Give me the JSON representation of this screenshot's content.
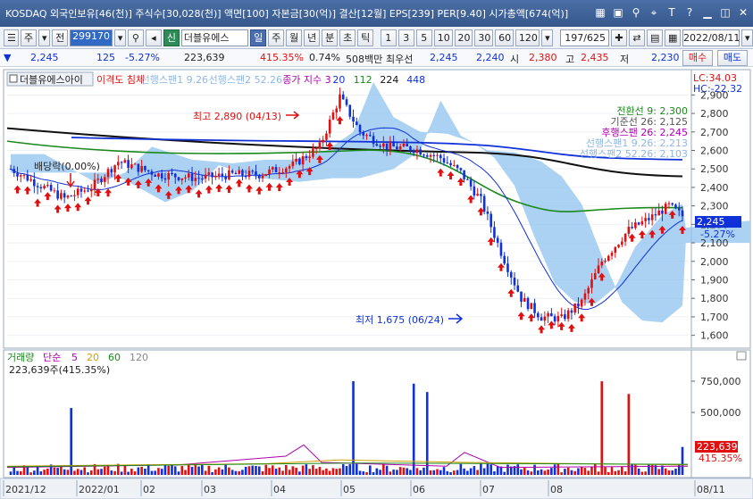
{
  "titlebar": {
    "title": "KOSDAQ 외국인보유[46(천)] 주식수[30,028(천)] 액면[100] 자본금[30(억)] 결산[12월] EPS[239] PER[9.40] 시가총액[674(억)]"
  },
  "toolbar": {
    "type_label": "주",
    "prev_label": "전",
    "code": "299170",
    "sin_label": "신",
    "name": "더블유에스",
    "periods": [
      "일",
      "주",
      "월",
      "년",
      "분",
      "초",
      "틱"
    ],
    "active_period": "일",
    "intervals": [
      "1",
      "3",
      "5",
      "10",
      "20",
      "30",
      "60",
      "120"
    ],
    "range_value": "197/625",
    "date_value": "2022/08/11"
  },
  "quote": {
    "price": "2,245",
    "change": "125",
    "change_pct": "-5.27%",
    "volume": "223,639",
    "volume_ratio": "415.35%",
    "turnover": "0.74%",
    "amount": "508백만",
    "priority_label": "최우선",
    "bid": "2,245",
    "ask": "2,240",
    "open_label": "시",
    "open": "2,380",
    "high_label": "고",
    "high": "2,435",
    "low_label": "저",
    "low": "2,230",
    "buy_label": "매수",
    "sell_label": "매도"
  },
  "legend": {
    "stock_name": "더블유에스아이",
    "items": [
      {
        "label": "이격도 침체",
        "color": "#e01010"
      },
      {
        "label": "선행스팬1 9.26",
        "color": "#8fb7e6"
      },
      {
        "label": "선행스팬2 52.26",
        "color": "#8fb7e6"
      },
      {
        "label": "종가 지수 3",
        "color": "#b000b0"
      },
      {
        "label": "20",
        "color": "#1030d8"
      },
      {
        "label": "112",
        "color": "#1a8a1a"
      },
      {
        "label": "224",
        "color": "#111111"
      },
      {
        "label": "448",
        "color": "#1030d8"
      }
    ],
    "lc": "LC:34.03",
    "hc": "HC:-22.32"
  },
  "ichimoku": [
    {
      "label": "전환선 9: 2,300",
      "color": "#1a8a1a"
    },
    {
      "label": "기준선 26: 2,125",
      "color": "#555555"
    },
    {
      "label": "후행스팬 26: 2,245",
      "color": "#b000b0"
    },
    {
      "label": "선행스팬1 9.26: 2,213",
      "color": "#8fb7e6"
    },
    {
      "label": "선행스팬2 52.26: 2,103",
      "color": "#8fb7e6"
    }
  ],
  "annotations": {
    "dividend": "배당락(0.00%)",
    "high": "최고 2,890 (04/13)",
    "low": "최저 1,675 (06/24)"
  },
  "price_axis": [
    "2,900",
    "2,800",
    "2,700",
    "2,600",
    "2,500",
    "2,400",
    "2,300",
    "2,200",
    "2,100",
    "2,000",
    "1,900",
    "1,800",
    "1,700",
    "1,600"
  ],
  "price_tag": {
    "price": "2,245",
    "pct": "-5.27%"
  },
  "volume_panel": {
    "title": "거래량",
    "ma_label": "단순",
    "ma_items": [
      {
        "label": "5",
        "color": "#b000b0"
      },
      {
        "label": "20",
        "color": "#d0a000"
      },
      {
        "label": "60",
        "color": "#1a8a1a"
      },
      {
        "label": "120",
        "color": "#888888"
      }
    ],
    "current": "223,639주(415.35%)",
    "axis": [
      "750,000",
      "500,000"
    ],
    "tag_value": "223,639",
    "tag_pct": "415.35%"
  },
  "x_axis": [
    "2021/12",
    "2022/01",
    "02",
    "03",
    "04",
    "05",
    "06",
    "07",
    "08",
    "08/11"
  ],
  "colors": {
    "up": "#e01010",
    "down": "#1030d8",
    "cloud": "#8fc3ef",
    "accent": "#35578c"
  },
  "chart_data": {
    "type": "candlestick",
    "ylim": [
      1550,
      2950
    ],
    "x_range": [
      "2021/12",
      "2022/08/11"
    ],
    "key_points": [
      {
        "date": "2022/04/13",
        "value": 2890,
        "label": "최고"
      },
      {
        "date": "2022/06/24",
        "value": 1675,
        "label": "최저"
      },
      {
        "date": "2022/08/11",
        "value": 2245,
        "label": "현재"
      }
    ]
  }
}
